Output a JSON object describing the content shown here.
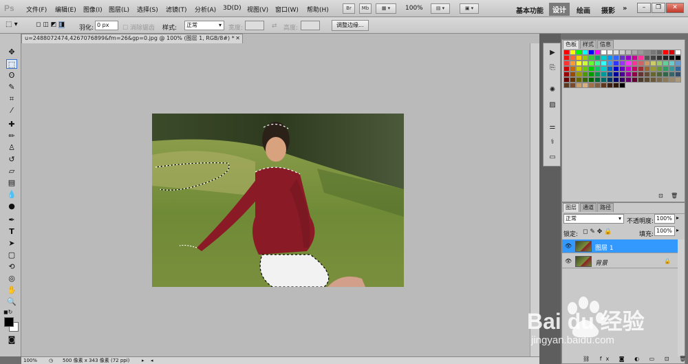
{
  "app_logo": "Ps",
  "menu": [
    "文件(F)",
    "编辑(E)",
    "图像(I)",
    "图层(L)",
    "选择(S)",
    "滤镜(T)",
    "分析(A)",
    "3D(D)",
    "视图(V)",
    "窗口(W)",
    "帮助(H)"
  ],
  "menubar_tools": {
    "br": "Br",
    "mb": "Mb",
    "zoom": "100%"
  },
  "workspaces": {
    "essentials": "基本功能",
    "design": "设计",
    "painting": "绘画",
    "photography": "摄影",
    "more": "»"
  },
  "options": {
    "feather_label": "羽化:",
    "feather_value": "0 px",
    "antialias_label": "消除锯齿",
    "style_label": "样式:",
    "style_value": "正常",
    "width_label": "宽度:",
    "height_label": "高度:",
    "refine_button": "调整边缘..."
  },
  "document": {
    "tab_title": "u=2488072474,4267076899&fm=26&gp=0.jpg @ 100% (图层 1, RGB/8#) *",
    "close": "✕"
  },
  "status": {
    "zoom": "100%",
    "info": "500 像素 x 343 像素 (72 ppi)"
  },
  "swatches_panel": {
    "tabs": [
      "色板",
      "样式",
      "信息"
    ]
  },
  "layers_panel": {
    "tabs": [
      "图层",
      "通道",
      "路径"
    ],
    "blend_mode": "正常",
    "opacity_label": "不透明度:",
    "opacity_value": "100%",
    "lock_label": "锁定:",
    "fill_label": "填充:",
    "fill_value": "100%",
    "layers": [
      {
        "name": "图层 1",
        "selected": true
      },
      {
        "name": "背景",
        "selected": false,
        "locked": true
      }
    ]
  },
  "watermark": {
    "brand": "Bai du 经验",
    "url": "jingyan.baidu.com"
  },
  "colors": {
    "selection": "#3399ff",
    "ui_bg": "#c9c9c9",
    "canvas_bg": "#bababa"
  }
}
